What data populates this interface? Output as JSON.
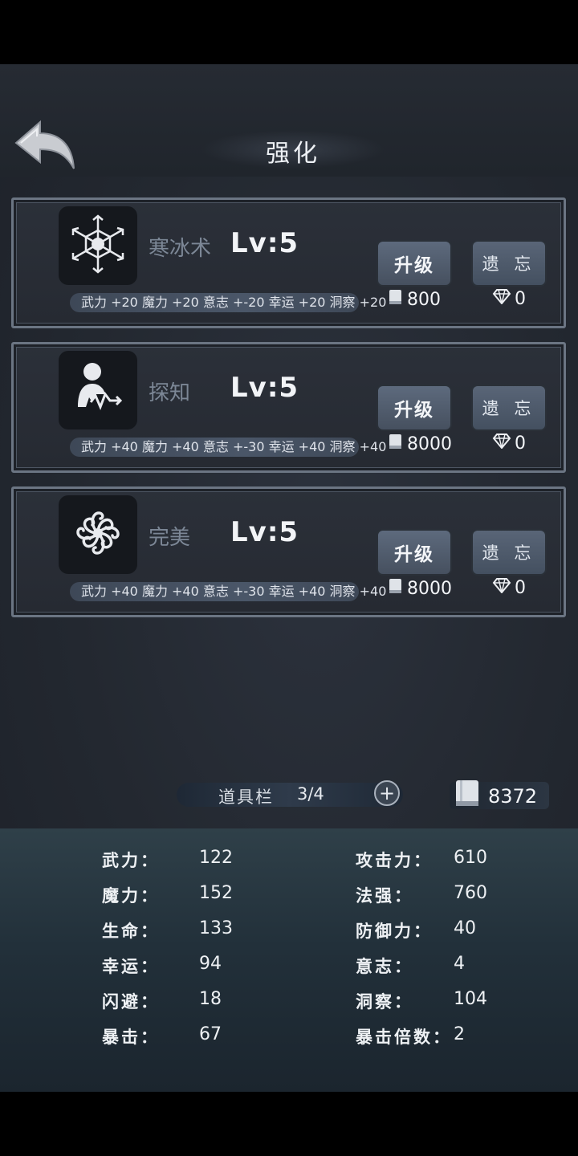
{
  "header": {
    "title": "强化"
  },
  "skills": [
    {
      "name": "寒冰术",
      "level": "Lv:5",
      "bonus": "武力 +20 魔力 +20 意志 +-20 幸运 +20 洞察 +20",
      "upgrade": "升级",
      "forget": "遗 忘",
      "book_cost": "800",
      "gem_cost": "0",
      "icon": "snowflake-icon"
    },
    {
      "name": "探知",
      "level": "Lv:5",
      "bonus": "武力 +40 魔力 +40 意志 +-30 幸运 +40 洞察 +40",
      "upgrade": "升级",
      "forget": "遗 忘",
      "book_cost": "8000",
      "gem_cost": "0",
      "icon": "person-pulse-icon"
    },
    {
      "name": "完美",
      "level": "Lv:5",
      "bonus": "武力 +40 魔力 +40 意志 +-30 幸运 +40 洞察 +40",
      "upgrade": "升级",
      "forget": "遗 忘",
      "book_cost": "8000",
      "gem_cost": "0",
      "icon": "swirl-icon"
    }
  ],
  "toolbar": {
    "label": "道具栏",
    "count": "3/4"
  },
  "books_total": "8372",
  "stats_left": [
    {
      "label": "武力：",
      "value": "122"
    },
    {
      "label": "魔力：",
      "value": "152"
    },
    {
      "label": "生命：",
      "value": "133"
    },
    {
      "label": "幸运：",
      "value": "94"
    },
    {
      "label": "闪避：",
      "value": "18"
    },
    {
      "label": "暴击：",
      "value": "67"
    }
  ],
  "stats_right": [
    {
      "label": "攻击力：",
      "value": "610"
    },
    {
      "label": "法强：",
      "value": "760"
    },
    {
      "label": "防御力：",
      "value": "40"
    },
    {
      "label": "意志：",
      "value": "4"
    },
    {
      "label": "洞察：",
      "value": "104"
    },
    {
      "label": "暴击倍数：",
      "value": "2"
    }
  ]
}
